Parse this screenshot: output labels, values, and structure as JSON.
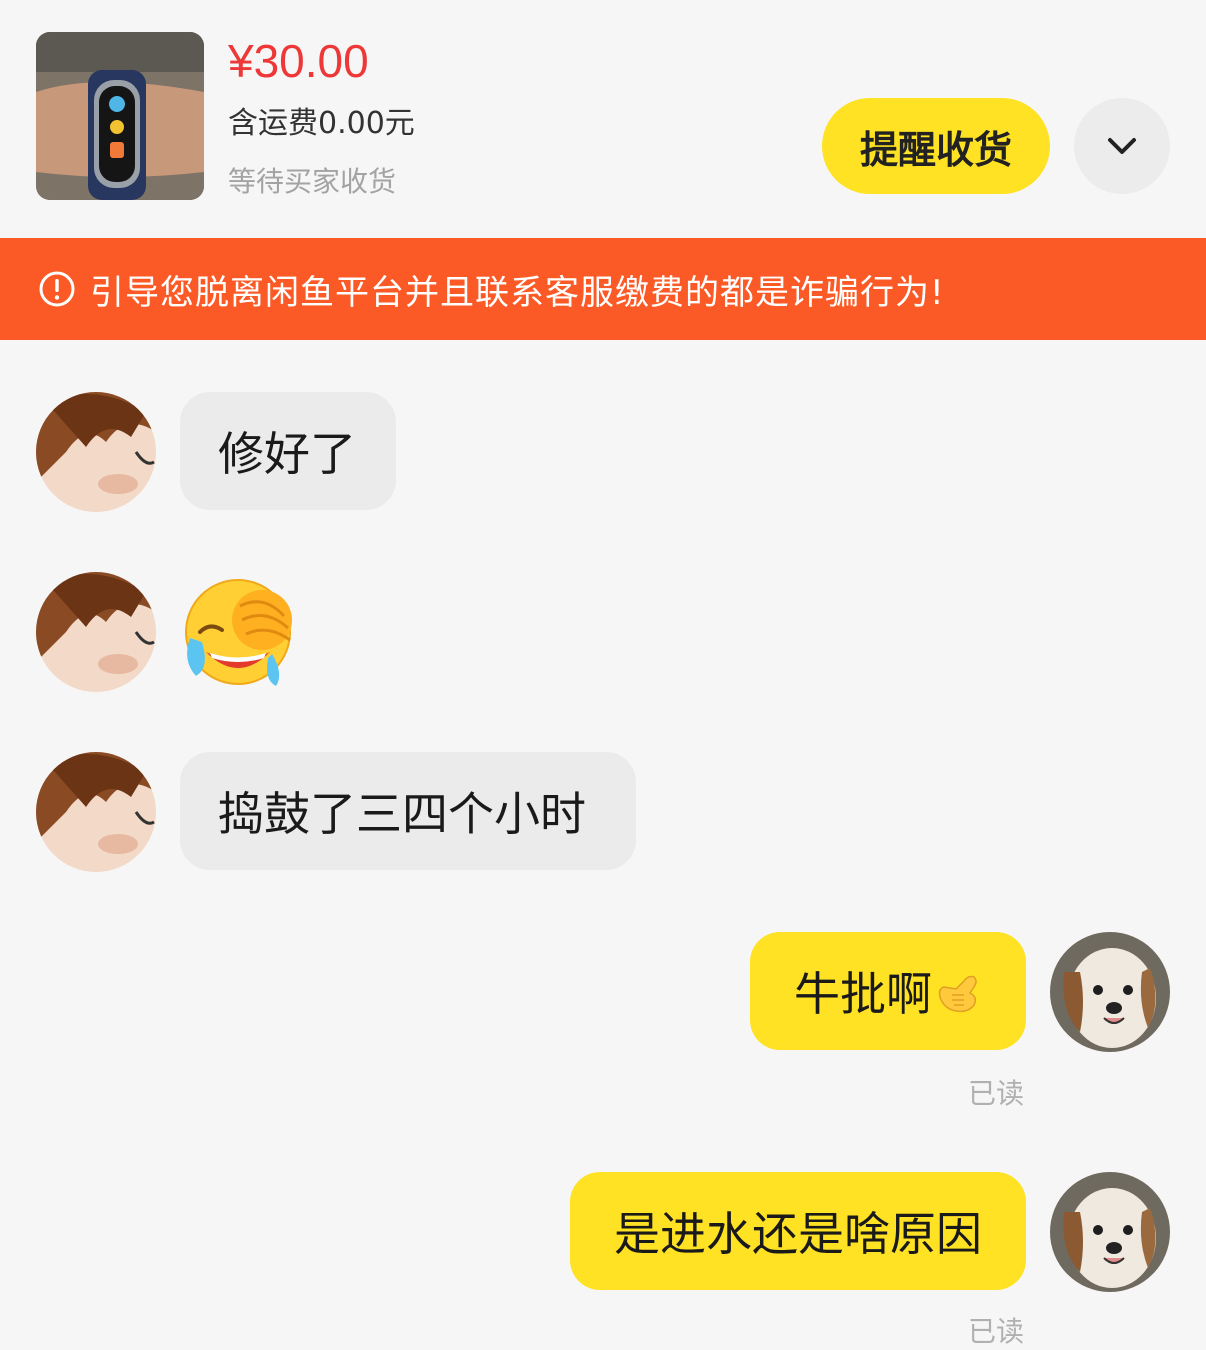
{
  "order": {
    "price": "¥30.00",
    "shipping": "含运费0.00元",
    "status": "等待买家收货",
    "remind_button": "提醒收货",
    "more_icon": "chevron-down-icon",
    "product_image": "smart-band-on-wrist"
  },
  "warning": {
    "icon": "alert-circle-icon",
    "text": "引导您脱离闲鱼平台并且联系客服缴费的都是诈骗行为!"
  },
  "messages": [
    {
      "sender": "other",
      "type": "text",
      "text": "修好了"
    },
    {
      "sender": "other",
      "type": "emoji",
      "emoji": "laughing-crying-emoji"
    },
    {
      "sender": "other",
      "type": "text",
      "text": "捣鼓了三四个小时"
    },
    {
      "sender": "me",
      "type": "text",
      "text": "牛批啊",
      "emoji": "call-me-hand-emoji",
      "read_status": "已读"
    },
    {
      "sender": "me",
      "type": "text",
      "text": "是进水还是啥原因",
      "read_status": "已读"
    }
  ],
  "colors": {
    "accent_yellow": "#ffe223",
    "price_red": "#ee3838",
    "warning_orange": "#fb5a26",
    "incoming_bubble": "#ebebeb",
    "background": "#f6f6f6"
  }
}
